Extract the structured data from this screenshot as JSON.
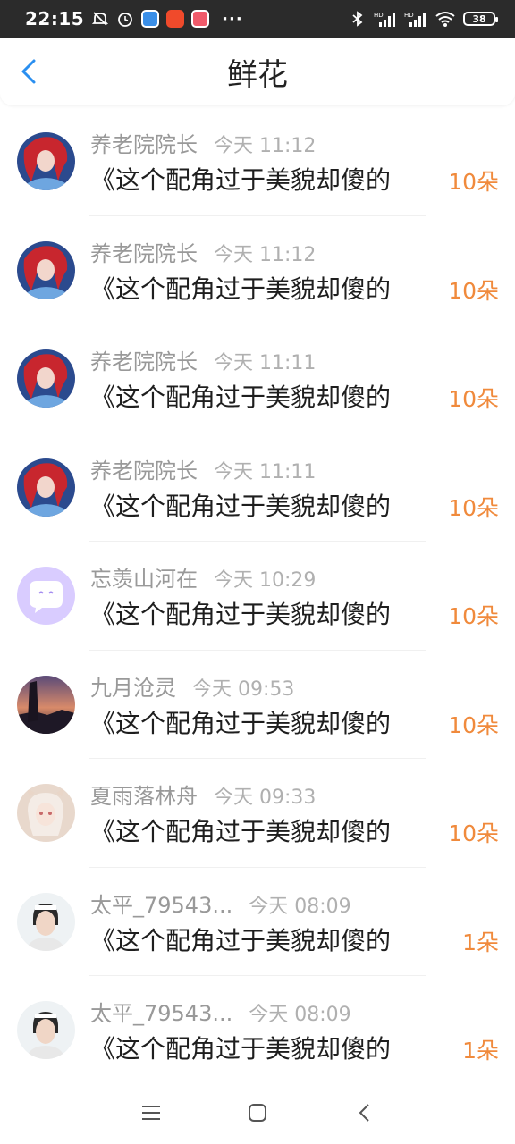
{
  "status_bar": {
    "time": "22:15",
    "battery": "38",
    "icons": [
      "mute-icon",
      "alarm-icon",
      "app-icon-1",
      "app-icon-2",
      "app-icon-3",
      "bluetooth-icon",
      "signal-hd-icon",
      "signal-hd-icon",
      "wifi-icon",
      "battery-icon"
    ],
    "more": "···"
  },
  "header": {
    "title": "鲜花",
    "back_icon": "chevron-left-icon",
    "accent_color": "#2a8ff0"
  },
  "list": [
    {
      "name": "养老院院长",
      "time": "今天 11:12",
      "message": "《这个配角过于美貌却傻的",
      "count": "10朵",
      "avatar": "red-hair"
    },
    {
      "name": "养老院院长",
      "time": "今天 11:12",
      "message": "《这个配角过于美貌却傻的",
      "count": "10朵",
      "avatar": "red-hair"
    },
    {
      "name": "养老院院长",
      "time": "今天 11:11",
      "message": "《这个配角过于美貌却傻的",
      "count": "10朵",
      "avatar": "red-hair"
    },
    {
      "name": "养老院院长",
      "time": "今天 11:11",
      "message": "《这个配角过于美貌却傻的",
      "count": "10朵",
      "avatar": "red-hair"
    },
    {
      "name": "忘羡山河在",
      "time": "今天 10:29",
      "message": "《这个配角过于美貌却傻的",
      "count": "10朵",
      "avatar": "default"
    },
    {
      "name": "九月沧灵",
      "time": "今天 09:53",
      "message": "《这个配角过于美貌却傻的",
      "count": "10朵",
      "avatar": "sunset"
    },
    {
      "name": "夏雨落林舟",
      "time": "今天 09:33",
      "message": "《这个配角过于美貌却傻的",
      "count": "10朵",
      "avatar": "anime-white"
    },
    {
      "name": "太平_79543...",
      "time": "今天 08:09",
      "message": "《这个配角过于美貌却傻的",
      "count": "1朵",
      "avatar": "photo"
    },
    {
      "name": "太平_79543...",
      "time": "今天 08:09",
      "message": "《这个配角过于美貌却傻的",
      "count": "1朵",
      "avatar": "photo"
    }
  ],
  "colors": {
    "count": "#f08a3c",
    "name": "#999999",
    "message": "#1e1e1e"
  },
  "nav": [
    "menu-icon",
    "home-icon",
    "back-icon"
  ]
}
